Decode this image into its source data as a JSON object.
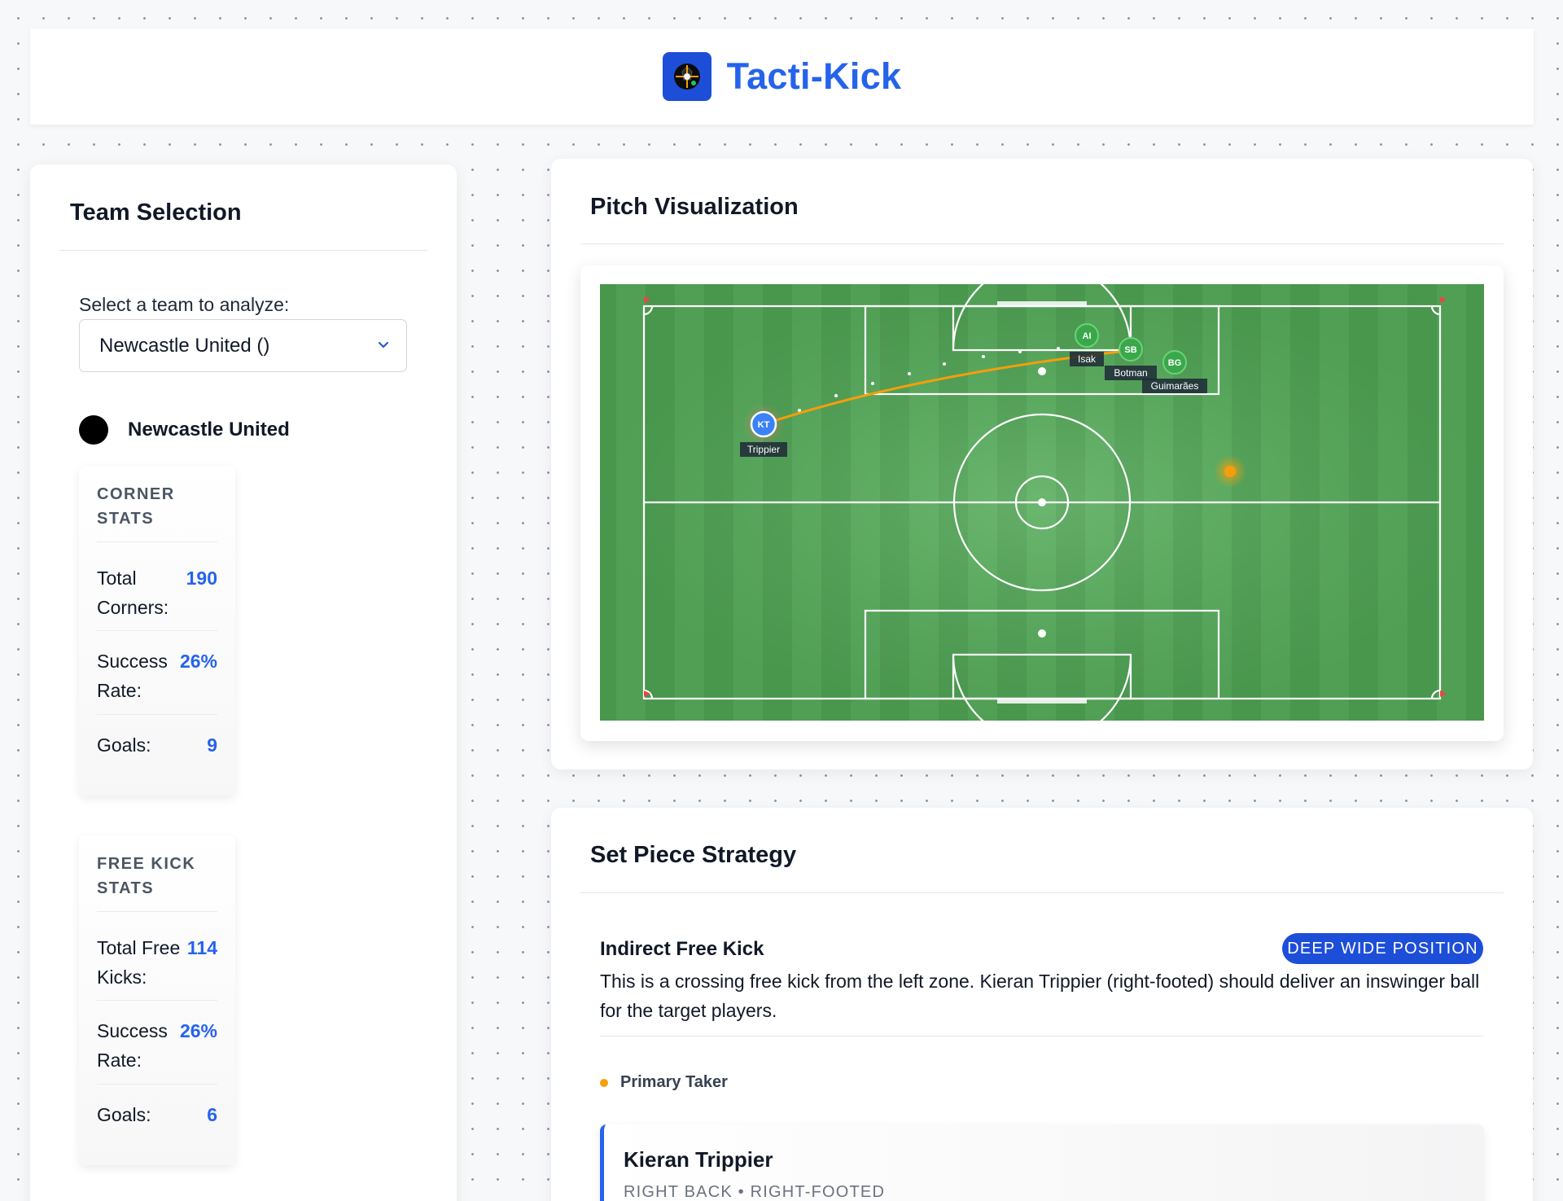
{
  "header": {
    "app_title": "Tacti-Kick"
  },
  "team_selection": {
    "title": "Team Selection",
    "select_label": "Select a team to analyze:",
    "selected_team": "Newcastle United ()",
    "team_name": "Newcastle United",
    "corner_stats": {
      "heading": "CORNER STATS",
      "total_label": "Total Corners:",
      "total_value": "190",
      "success_label": "Success Rate:",
      "success_value": "26%",
      "goals_label": "Goals:",
      "goals_value": "9"
    },
    "free_kick_stats": {
      "heading": "FREE KICK STATS",
      "total_label": "Total Free Kicks:",
      "total_value": "114",
      "success_label": "Success Rate:",
      "success_value": "26%",
      "goals_label": "Goals:",
      "goals_value": "6"
    }
  },
  "pitch": {
    "title": "Pitch Visualization",
    "players": [
      {
        "initials": "KT",
        "name": "Trippier",
        "role": "taker"
      },
      {
        "initials": "AI",
        "name": "Isak",
        "role": "target"
      },
      {
        "initials": "SB",
        "name": "Botman",
        "role": "target"
      },
      {
        "initials": "BG",
        "name": "Guimarães",
        "role": "target"
      }
    ]
  },
  "strategy": {
    "title": "Set Piece Strategy",
    "subtitle": "Indirect Free Kick",
    "badge": "DEEP WIDE POSITION",
    "description": "This is a crossing free kick from the left zone. Kieran Trippier (right-footed) should deliver an inswinger ball for the target players.",
    "primary_label": "Primary Taker",
    "taker_name": "Kieran Trippier",
    "taker_meta": "RIGHT BACK • RIGHT-FOOTED"
  },
  "colors": {
    "accent": "#2563eb",
    "pitch_green": "#4fa354",
    "target_green": "#3aa84a",
    "taker_blue": "#3b82f6",
    "trajectory": "#f59e0b"
  }
}
